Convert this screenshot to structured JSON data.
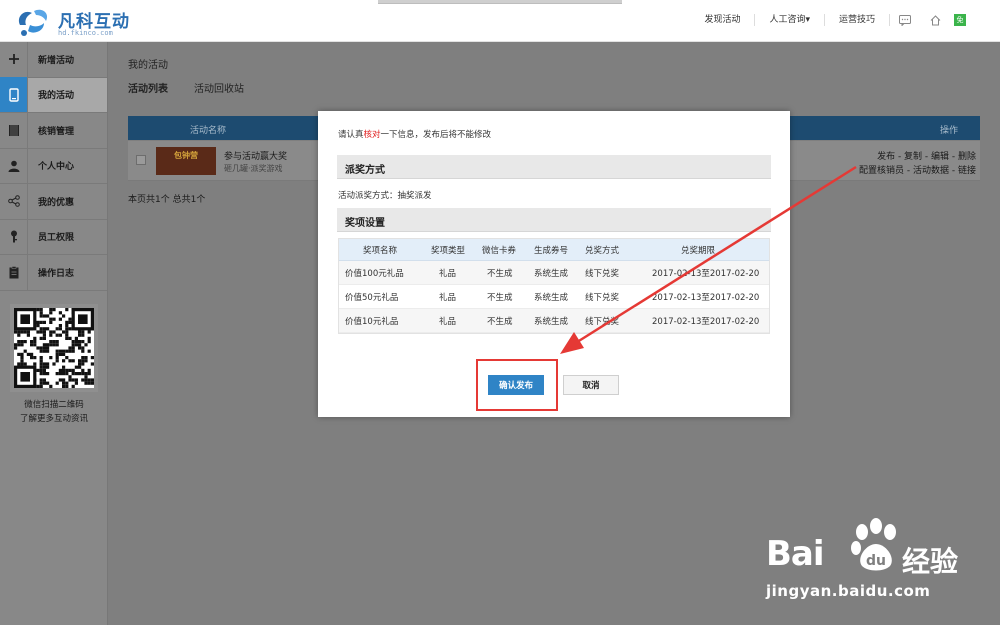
{
  "header": {
    "brand": "凡科互动",
    "brand_sub": "hd.fkinco.com",
    "nav": [
      "发现活动",
      "人工咨询▾",
      "运营技巧"
    ],
    "free_badge": "免"
  },
  "sidebar": {
    "items": [
      {
        "label": "新增活动",
        "icon": "plus-icon"
      },
      {
        "label": "我的活动",
        "icon": "phone-icon",
        "active": true
      },
      {
        "label": "核销管理",
        "icon": "ledger-icon"
      },
      {
        "label": "个人中心",
        "icon": "user-icon"
      },
      {
        "label": "我的优惠",
        "icon": "share-icon"
      },
      {
        "label": "员工权限",
        "icon": "key-icon"
      },
      {
        "label": "操作日志",
        "icon": "clipboard-icon"
      }
    ],
    "qr_caption_1": "微信扫描二维码",
    "qr_caption_2": "了解更多互动资讯"
  },
  "main": {
    "crumb": "我的活动",
    "tabs": [
      "活动列表",
      "活动回收站"
    ],
    "table_header": {
      "name": "活动名称",
      "ops": "操作"
    },
    "row": {
      "thumb_text": "包钟营",
      "title": "参与活动赢大奖",
      "sub": "砸几罐·派奖游戏",
      "ops_line1": "发布 - 复制 - 编辑 - 删除",
      "ops_line2": "配置核销员 - 活动数据 - 链接"
    },
    "pager": "本页共1个  总共1个"
  },
  "modal": {
    "notice_pre": "请认真",
    "notice_red": "核对",
    "notice_post": "一下信息，发布后将不能修改",
    "section1": "派奖方式",
    "method_line": "活动派奖方式：抽奖派发",
    "section2": "奖项设置",
    "columns": [
      "奖项名称",
      "奖项类型",
      "微信卡券",
      "生成券号",
      "兑奖方式",
      "兑奖期限"
    ],
    "rows": [
      [
        "价值100元礼品",
        "礼品",
        "不生成",
        "系统生成",
        "线下兑奖",
        "2017-02-13至2017-02-20"
      ],
      [
        "价值50元礼品",
        "礼品",
        "不生成",
        "系统生成",
        "线下兑奖",
        "2017-02-13至2017-02-20"
      ],
      [
        "价值10元礼品",
        "礼品",
        "不生成",
        "系统生成",
        "线下兑奖",
        "2017-02-13至2017-02-20"
      ]
    ],
    "confirm": "确认发布",
    "cancel": "取消"
  },
  "watermark": {
    "bai": "Bai",
    "cn": "经验",
    "url": "jingyan.baidu.com"
  },
  "colors": {
    "accent": "#2f84c6",
    "highlight": "#e53935",
    "notice_red": "#e02020"
  }
}
